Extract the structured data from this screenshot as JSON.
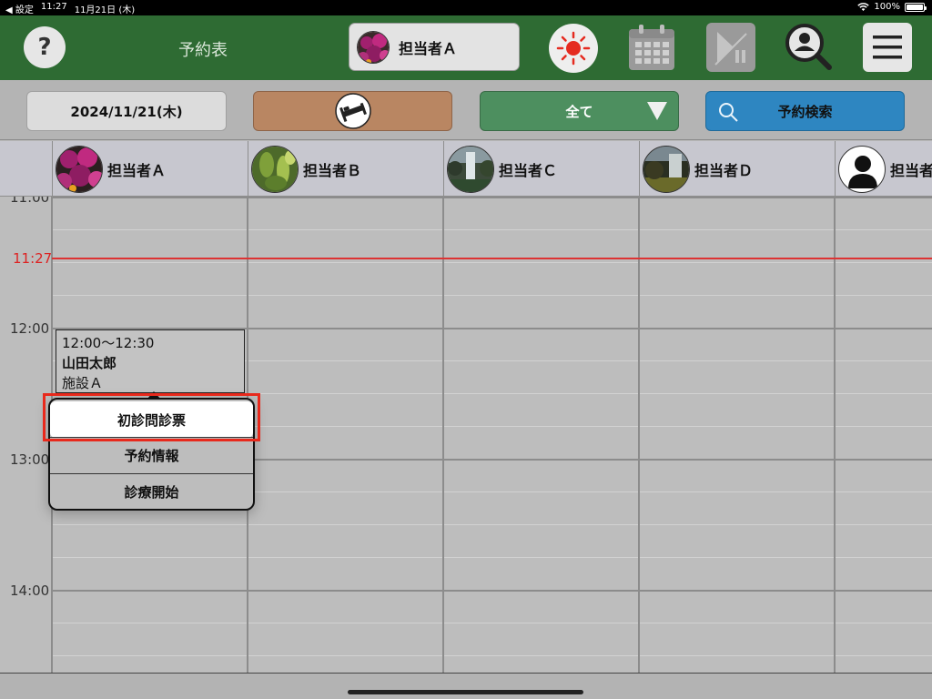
{
  "status_bar": {
    "back_label": "◀ 設定",
    "time": "11:27",
    "date": "11月21日 (木)",
    "battery": "100%"
  },
  "header": {
    "help_symbol": "?",
    "title": "予約表",
    "selected_staff": "担当者Ａ"
  },
  "toolbar": {
    "date": "2024/11/21(木)",
    "filter": "全て",
    "search": "予約検索"
  },
  "staff": [
    {
      "name": "担当者Ａ",
      "avatar": "flowers"
    },
    {
      "name": "担当者Ｂ",
      "avatar": "leaves"
    },
    {
      "name": "担当者Ｃ",
      "avatar": "waterfall"
    },
    {
      "name": "担当者Ｄ",
      "avatar": "waterfall-dark"
    },
    {
      "name": "担当者Ｅ",
      "avatar": "person-silhouette"
    }
  ],
  "time_labels": [
    "11:00",
    "12:00",
    "13:00",
    "14:00"
  ],
  "now_label": "11:27",
  "appointment": {
    "time": "12:00～12:30",
    "patient": "山田太郎",
    "facility": "施設Ａ"
  },
  "popover_menu": [
    "初診問診票",
    "予約情報",
    "診療開始"
  ],
  "colors": {
    "header_green": "#2e6b33",
    "now_line": "#dd3333",
    "highlight": "#e8291c"
  }
}
